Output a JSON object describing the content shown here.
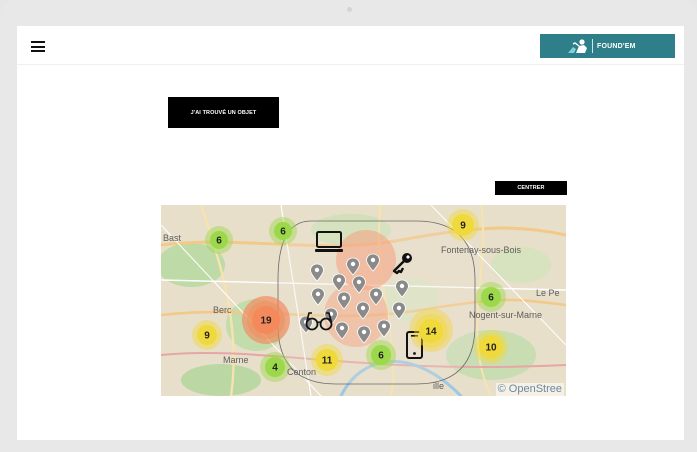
{
  "header": {
    "menu_icon": "hamburger-menu-icon",
    "logo": {
      "icon": "person-found-icon",
      "text": "FOUND'EM",
      "background": "#2f7f8a"
    }
  },
  "actions": {
    "found_object_label": "J'AI TROUVÉ UN OBJET",
    "center_label": "CENTRER"
  },
  "map": {
    "attribution": "© OpenStree",
    "place_labels": [
      "Bast",
      "Fontenay-sous-Bois",
      "Le Pe",
      "Nogent-sur-Marne",
      "Berc",
      "Centon",
      "ille",
      "Marne"
    ],
    "clusters": [
      {
        "count": "6",
        "color": "#9bd84a"
      },
      {
        "count": "6",
        "color": "#9bd84a"
      },
      {
        "count": "9",
        "color": "#f0d93a"
      },
      {
        "count": "6",
        "color": "#9bd84a"
      },
      {
        "count": "9",
        "color": "#f0d93a"
      },
      {
        "count": "19",
        "color": "#f48a5c"
      },
      {
        "count": "4",
        "color": "#9bd84a"
      },
      {
        "count": "11",
        "color": "#f0d93a"
      },
      {
        "count": "6",
        "color": "#9bd84a"
      },
      {
        "count": "14",
        "color": "#f0d93a"
      },
      {
        "count": "10",
        "color": "#f0d93a"
      }
    ],
    "object_icons": [
      "laptop-icon",
      "key-icon",
      "glasses-icon",
      "smartphone-icon"
    ],
    "marker_color": "#8a8a8a"
  }
}
